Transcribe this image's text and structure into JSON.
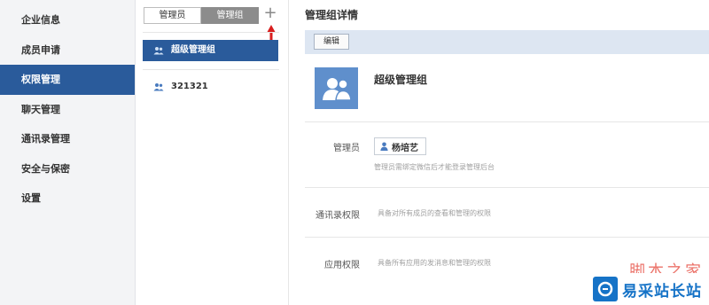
{
  "sidebar": {
    "items": [
      {
        "label": "企业信息"
      },
      {
        "label": "成员申请"
      },
      {
        "label": "权限管理"
      },
      {
        "label": "聊天管理"
      },
      {
        "label": "通讯录管理"
      },
      {
        "label": "安全与保密"
      },
      {
        "label": "设置"
      }
    ],
    "active_index": 2
  },
  "middle": {
    "tabs": [
      {
        "label": "管理员"
      },
      {
        "label": "管理组"
      }
    ],
    "active_tab": 1,
    "add_symbol": "+",
    "groups": [
      {
        "label": "超级管理组",
        "icon": "group-icon"
      },
      {
        "label": "321321",
        "icon": "group-icon"
      }
    ]
  },
  "detail": {
    "title": "管理组详情",
    "edit_label": "编辑",
    "group_name": "超级管理组",
    "admin": {
      "label": "管理员",
      "name": "杨培艺",
      "hint": "管理员需绑定微信后才能登录管理后台"
    },
    "contacts": {
      "label": "通讯录权限",
      "hint": "具备对所有成员的查看和管理的权限"
    },
    "apps": {
      "label": "应用权限",
      "hint": "具备所有应用的发消息和管理的权限"
    }
  },
  "watermark": {
    "text": "脚本之家",
    "site_name": "易采站长站"
  },
  "colors": {
    "accent": "#2a5b9b",
    "avatar": "#5f8fcc",
    "toolbar": "#dde6f2",
    "annotation_arrow": "#d81e1e"
  }
}
